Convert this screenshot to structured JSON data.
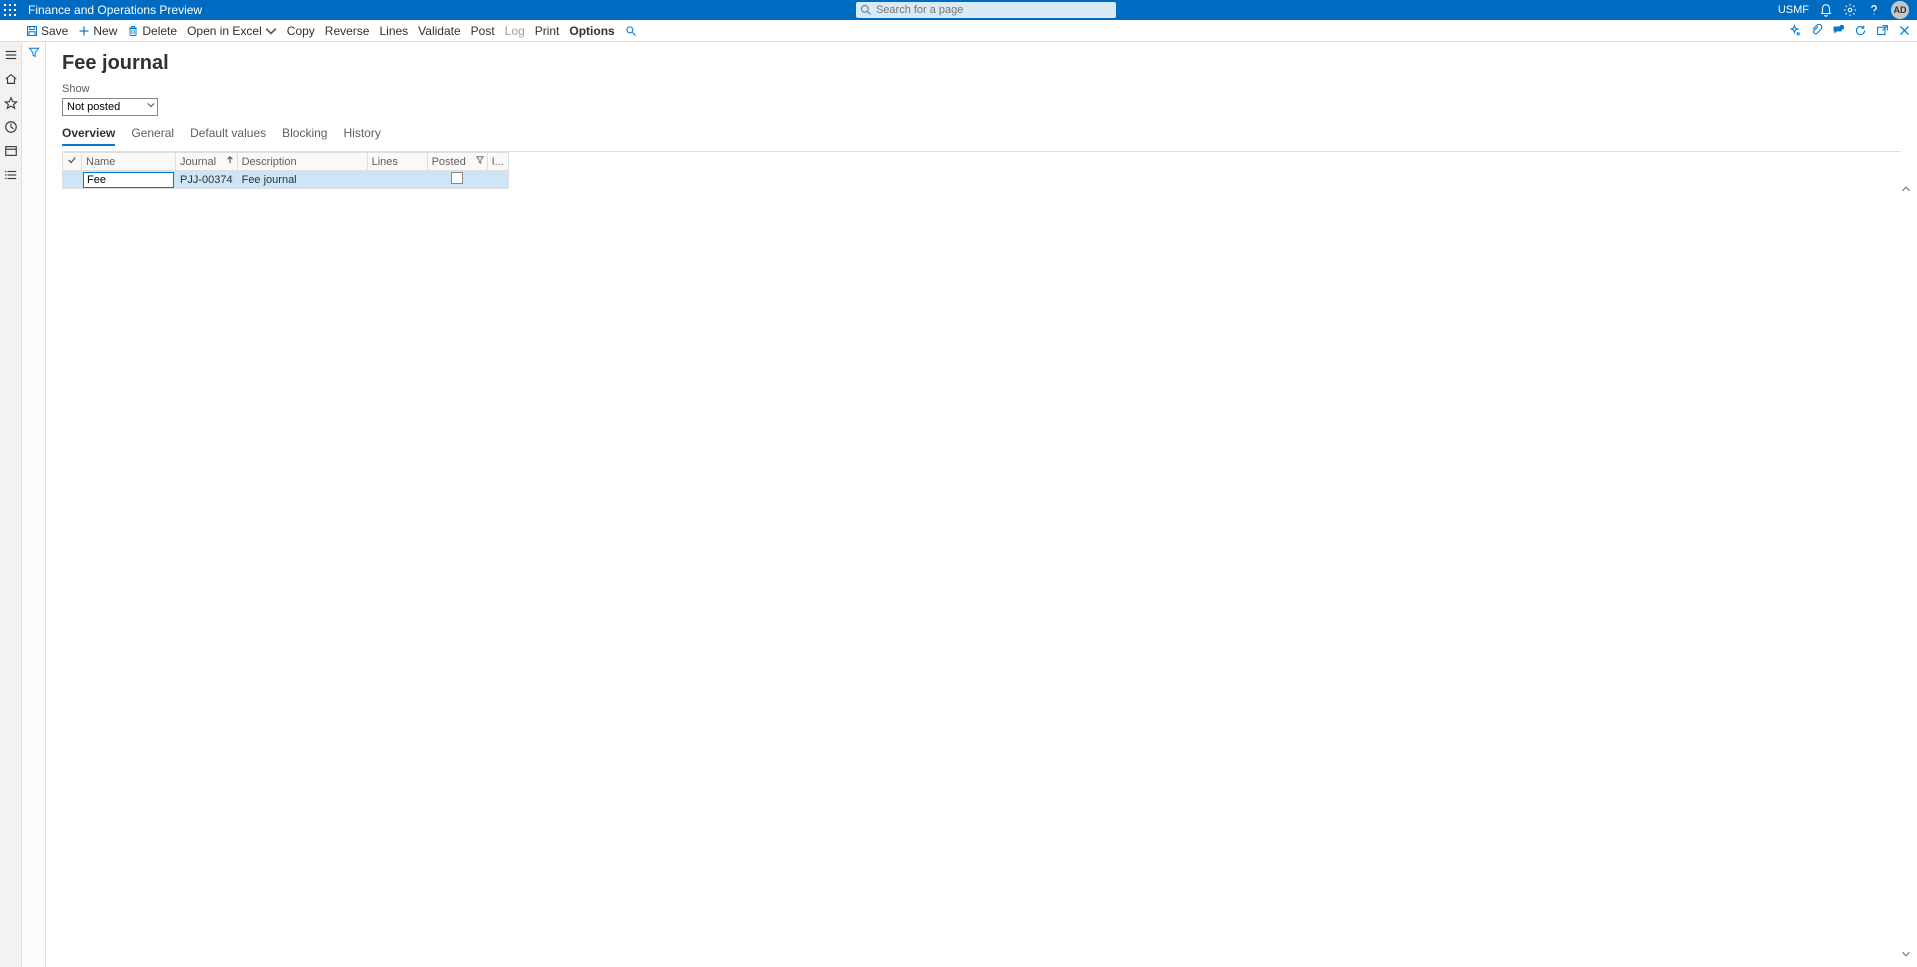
{
  "brand": {
    "title": "Finance and Operations Preview",
    "search_placeholder": "Search for a page",
    "company": "USMF",
    "avatar_initials": "AD"
  },
  "actions": {
    "save": "Save",
    "new_": "New",
    "delete_": "Delete",
    "open_excel": "Open in Excel",
    "copy": "Copy",
    "reverse": "Reverse",
    "lines": "Lines",
    "validate": "Validate",
    "post": "Post",
    "log": "Log",
    "print": "Print",
    "options": "Options"
  },
  "page": {
    "title": "Fee journal",
    "show_label": "Show",
    "show_value": "Not posted"
  },
  "tabs": {
    "overview": "Overview",
    "general": "General",
    "default_values": "Default values",
    "blocking": "Blocking",
    "history": "History"
  },
  "grid": {
    "headers": {
      "name": "Name",
      "journal": "Journal",
      "description": "Description",
      "lines": "Lines",
      "posted": "Posted",
      "last": "I..."
    },
    "rows": [
      {
        "name": "Fee",
        "journal": "PJJ-00374",
        "description": "Fee journal",
        "lines": "",
        "posted": false
      }
    ]
  }
}
